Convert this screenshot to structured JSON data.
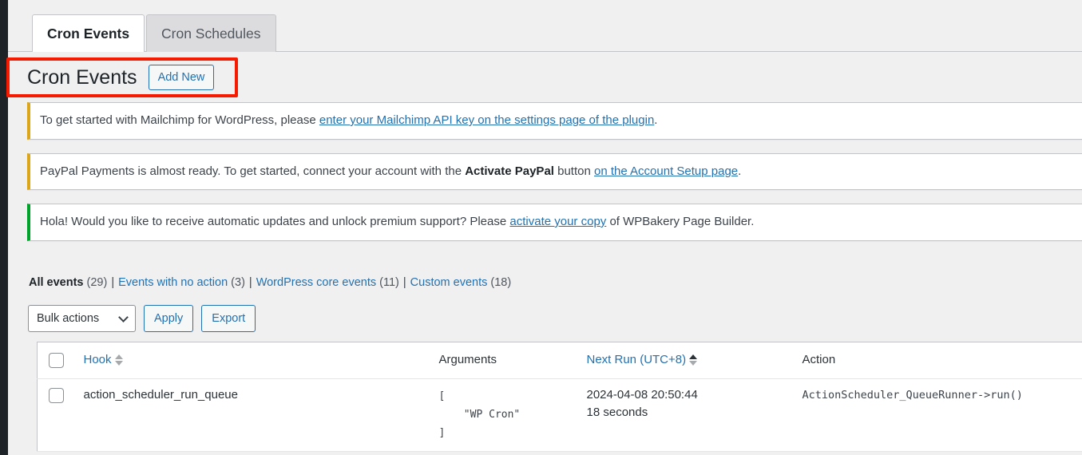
{
  "theme": {
    "accent": "#2271b1",
    "text": "#1d2327",
    "page_bg": "#f0f0f1",
    "annotation_red": "#f61b00",
    "notice_warning": "#dba617",
    "notice_success": "#00a32a"
  },
  "tabs": [
    {
      "label": "Cron Events",
      "active": true
    },
    {
      "label": "Cron Schedules",
      "active": false
    }
  ],
  "header": {
    "title": "Cron Events",
    "add_new_label": "Add New"
  },
  "notices": [
    {
      "type": "warning",
      "segments": [
        {
          "kind": "text",
          "text": "To get started with Mailchimp for WordPress, please "
        },
        {
          "kind": "link",
          "text": "enter your Mailchimp API key on the settings page of the plugin"
        },
        {
          "kind": "text",
          "text": "."
        }
      ]
    },
    {
      "type": "warning",
      "segments": [
        {
          "kind": "text",
          "text": "PayPal Payments is almost ready. To get started, connect your account with the "
        },
        {
          "kind": "bold",
          "text": "Activate PayPal"
        },
        {
          "kind": "text",
          "text": " button "
        },
        {
          "kind": "link",
          "text": "on the Account Setup page"
        },
        {
          "kind": "text",
          "text": "."
        }
      ]
    },
    {
      "type": "success",
      "segments": [
        {
          "kind": "text",
          "text": "Hola! Would you like to receive automatic updates and unlock premium support? Please "
        },
        {
          "kind": "link",
          "text": "activate your copy"
        },
        {
          "kind": "text",
          "text": " of WPBakery Page Builder."
        }
      ]
    }
  ],
  "filters": [
    {
      "label": "All events",
      "count": "(29)",
      "current": true
    },
    {
      "label": "Events with no action",
      "count": "(3)",
      "current": false
    },
    {
      "label": "WordPress core events",
      "count": "(11)",
      "current": false
    },
    {
      "label": "Custom events",
      "count": "(18)",
      "current": false
    }
  ],
  "filter_separator": "|",
  "tablenav": {
    "bulk_actions_label": "Bulk actions",
    "apply_label": "Apply",
    "export_label": "Export"
  },
  "table": {
    "columns": {
      "hook": "Hook",
      "arguments": "Arguments",
      "next_run": "Next Run (UTC+8)",
      "action": "Action"
    },
    "sort": {
      "hook": "none",
      "next_run": "asc"
    },
    "rows": [
      {
        "hook": "action_scheduler_run_queue",
        "arguments": "[\n    \"WP Cron\"\n]",
        "next_run_date": "2024-04-08 20:50:44",
        "next_run_relative": "18 seconds",
        "action": "ActionScheduler_QueueRunner->run()"
      }
    ]
  }
}
